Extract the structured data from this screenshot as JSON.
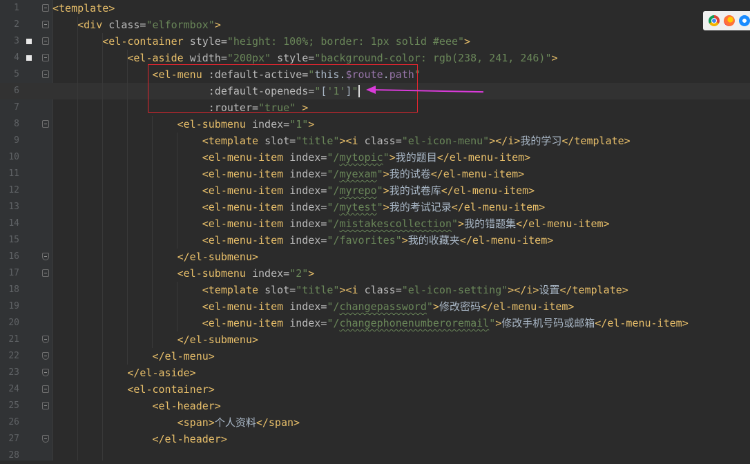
{
  "lines": [
    {
      "n": "1",
      "marker": false,
      "fold": "open",
      "tokens": [
        [
          "t",
          "<template>"
        ]
      ]
    },
    {
      "n": "2",
      "marker": false,
      "fold": "open",
      "tokens": [
        [
          "w",
          "    "
        ],
        [
          "t",
          "<div "
        ],
        [
          "a",
          "class="
        ],
        [
          "s",
          "\"elformbox\""
        ],
        [
          "t",
          ">"
        ]
      ]
    },
    {
      "n": "3",
      "marker": true,
      "fold": "open",
      "tokens": [
        [
          "w",
          "        "
        ],
        [
          "t",
          "<el-container "
        ],
        [
          "a",
          "style="
        ],
        [
          "s",
          "\"height: 100%; border: 1px solid #eee\""
        ],
        [
          "t",
          ">"
        ]
      ]
    },
    {
      "n": "4",
      "marker": true,
      "fold": "open",
      "tokens": [
        [
          "w",
          "            "
        ],
        [
          "t",
          "<el-aside "
        ],
        [
          "a",
          "width="
        ],
        [
          "s",
          "\"200px\" "
        ],
        [
          "a",
          "style="
        ],
        [
          "s",
          "\"background-color: rgb(238, 241, 246)\""
        ],
        [
          "t",
          ">"
        ]
      ]
    },
    {
      "n": "5",
      "marker": false,
      "fold": "open",
      "tokens": [
        [
          "w",
          "                "
        ],
        [
          "t",
          "<el-menu "
        ],
        [
          "a",
          ":default-active="
        ],
        [
          "s",
          "\""
        ],
        [
          "w",
          "this."
        ],
        [
          "vexpr",
          "$route"
        ],
        [
          "w",
          "."
        ],
        [
          "vexpr",
          "path"
        ],
        [
          "s",
          "\""
        ]
      ]
    },
    {
      "n": "6",
      "marker": false,
      "fold": "",
      "current": true,
      "tokens": [
        [
          "w",
          "                         "
        ],
        [
          "a",
          ":default-openeds="
        ],
        [
          "s",
          "\""
        ],
        [
          "w",
          "["
        ],
        [
          "s",
          "'1'"
        ],
        [
          "w",
          "]"
        ],
        [
          "s",
          "\""
        ]
      ]
    },
    {
      "n": "7",
      "marker": false,
      "fold": "",
      "tokens": [
        [
          "w",
          "                         "
        ],
        [
          "a",
          ":router="
        ],
        [
          "s",
          "\"true\" "
        ],
        [
          "t",
          ">"
        ]
      ]
    },
    {
      "n": "8",
      "marker": false,
      "fold": "open",
      "tokens": [
        [
          "w",
          "                    "
        ],
        [
          "t",
          "<el-submenu "
        ],
        [
          "a",
          "index="
        ],
        [
          "s",
          "\"1\""
        ],
        [
          "t",
          ">"
        ]
      ]
    },
    {
      "n": "9",
      "marker": false,
      "fold": "",
      "tokens": [
        [
          "w",
          "                        "
        ],
        [
          "t",
          "<template "
        ],
        [
          "a",
          "slot="
        ],
        [
          "s",
          "\"title\""
        ],
        [
          "t",
          "><i "
        ],
        [
          "a",
          "class="
        ],
        [
          "s",
          "\"el-icon-menu\""
        ],
        [
          "t",
          "></i>"
        ],
        [
          "w",
          "我的学习"
        ],
        [
          "t",
          "</template>"
        ]
      ]
    },
    {
      "n": "10",
      "marker": false,
      "fold": "",
      "tokens": [
        [
          "w",
          "                        "
        ],
        [
          "t",
          "<el-menu-item "
        ],
        [
          "a",
          "index="
        ],
        [
          "s",
          "\"/"
        ],
        [
          "sq",
          "mytopic"
        ],
        [
          "s",
          "\""
        ],
        [
          "t",
          ">"
        ],
        [
          "w",
          "我的题目"
        ],
        [
          "t",
          "</el-menu-item>"
        ]
      ]
    },
    {
      "n": "11",
      "marker": false,
      "fold": "",
      "tokens": [
        [
          "w",
          "                        "
        ],
        [
          "t",
          "<el-menu-item "
        ],
        [
          "a",
          "index="
        ],
        [
          "s",
          "\"/"
        ],
        [
          "sq",
          "myexam"
        ],
        [
          "s",
          "\""
        ],
        [
          "t",
          ">"
        ],
        [
          "w",
          "我的试卷"
        ],
        [
          "t",
          "</el-menu-item>"
        ]
      ]
    },
    {
      "n": "12",
      "marker": false,
      "fold": "",
      "tokens": [
        [
          "w",
          "                        "
        ],
        [
          "t",
          "<el-menu-item "
        ],
        [
          "a",
          "index="
        ],
        [
          "s",
          "\"/"
        ],
        [
          "sq",
          "myrepo"
        ],
        [
          "s",
          "\""
        ],
        [
          "t",
          ">"
        ],
        [
          "w",
          "我的试卷库"
        ],
        [
          "t",
          "</el-menu-item>"
        ]
      ]
    },
    {
      "n": "13",
      "marker": false,
      "fold": "",
      "tokens": [
        [
          "w",
          "                        "
        ],
        [
          "t",
          "<el-menu-item "
        ],
        [
          "a",
          "index="
        ],
        [
          "s",
          "\"/"
        ],
        [
          "sq",
          "mytest"
        ],
        [
          "s",
          "\""
        ],
        [
          "t",
          ">"
        ],
        [
          "w",
          "我的考试记录"
        ],
        [
          "t",
          "</el-menu-item>"
        ]
      ]
    },
    {
      "n": "14",
      "marker": false,
      "fold": "",
      "tokens": [
        [
          "w",
          "                        "
        ],
        [
          "t",
          "<el-menu-item "
        ],
        [
          "a",
          "index="
        ],
        [
          "s",
          "\"/"
        ],
        [
          "sq",
          "mistakescollection"
        ],
        [
          "s",
          "\""
        ],
        [
          "t",
          ">"
        ],
        [
          "w",
          "我的错题集"
        ],
        [
          "t",
          "</el-menu-item>"
        ]
      ]
    },
    {
      "n": "15",
      "marker": false,
      "fold": "",
      "tokens": [
        [
          "w",
          "                        "
        ],
        [
          "t",
          "<el-menu-item "
        ],
        [
          "a",
          "index="
        ],
        [
          "s",
          "\"/favorites\""
        ],
        [
          "t",
          ">"
        ],
        [
          "w",
          "我的收藏夹"
        ],
        [
          "t",
          "</el-menu-item>"
        ]
      ]
    },
    {
      "n": "16",
      "marker": false,
      "fold": "end",
      "tokens": [
        [
          "w",
          "                    "
        ],
        [
          "t",
          "</el-submenu>"
        ]
      ]
    },
    {
      "n": "17",
      "marker": false,
      "fold": "open",
      "tokens": [
        [
          "w",
          "                    "
        ],
        [
          "t",
          "<el-submenu "
        ],
        [
          "a",
          "index="
        ],
        [
          "s",
          "\"2\""
        ],
        [
          "t",
          ">"
        ]
      ]
    },
    {
      "n": "18",
      "marker": false,
      "fold": "",
      "tokens": [
        [
          "w",
          "                        "
        ],
        [
          "t",
          "<template "
        ],
        [
          "a",
          "slot="
        ],
        [
          "s",
          "\"title\""
        ],
        [
          "t",
          "><i "
        ],
        [
          "a",
          "class="
        ],
        [
          "s",
          "\"el-icon-setting\""
        ],
        [
          "t",
          "></i>"
        ],
        [
          "w",
          "设置"
        ],
        [
          "t",
          "</template>"
        ]
      ]
    },
    {
      "n": "19",
      "marker": false,
      "fold": "",
      "tokens": [
        [
          "w",
          "                        "
        ],
        [
          "t",
          "<el-menu-item "
        ],
        [
          "a",
          "index="
        ],
        [
          "s",
          "\"/"
        ],
        [
          "sq",
          "changepassword"
        ],
        [
          "s",
          "\""
        ],
        [
          "t",
          ">"
        ],
        [
          "w",
          "修改密码"
        ],
        [
          "t",
          "</el-menu-item>"
        ]
      ]
    },
    {
      "n": "20",
      "marker": false,
      "fold": "",
      "tokens": [
        [
          "w",
          "                        "
        ],
        [
          "t",
          "<el-menu-item "
        ],
        [
          "a",
          "index="
        ],
        [
          "s",
          "\"/"
        ],
        [
          "sq",
          "changephonenumberoremail"
        ],
        [
          "s",
          "\""
        ],
        [
          "t",
          ">"
        ],
        [
          "w",
          "修改手机号码或邮箱"
        ],
        [
          "t",
          "</el-menu-item>"
        ]
      ]
    },
    {
      "n": "21",
      "marker": false,
      "fold": "end",
      "tokens": [
        [
          "w",
          "                    "
        ],
        [
          "t",
          "</el-submenu>"
        ]
      ]
    },
    {
      "n": "22",
      "marker": false,
      "fold": "end",
      "tokens": [
        [
          "w",
          "                "
        ],
        [
          "t",
          "</el-menu>"
        ]
      ]
    },
    {
      "n": "23",
      "marker": false,
      "fold": "end",
      "tokens": [
        [
          "w",
          "            "
        ],
        [
          "t",
          "</el-aside>"
        ]
      ]
    },
    {
      "n": "24",
      "marker": false,
      "fold": "open",
      "tokens": [
        [
          "w",
          "            "
        ],
        [
          "t",
          "<el-container>"
        ]
      ]
    },
    {
      "n": "25",
      "marker": false,
      "fold": "open",
      "tokens": [
        [
          "w",
          "                "
        ],
        [
          "t",
          "<el-header>"
        ]
      ]
    },
    {
      "n": "26",
      "marker": false,
      "fold": "",
      "tokens": [
        [
          "w",
          "                    "
        ],
        [
          "t",
          "<span>"
        ],
        [
          "w",
          "个人资料"
        ],
        [
          "t",
          "</span>"
        ]
      ]
    },
    {
      "n": "27",
      "marker": false,
      "fold": "end",
      "tokens": [
        [
          "w",
          "                "
        ],
        [
          "t",
          "</el-header>"
        ]
      ]
    },
    {
      "n": "28",
      "marker": false,
      "fold": "",
      "tokens": []
    }
  ],
  "browser_icons": [
    "chrome-icon",
    "firefox-icon",
    "safari-icon"
  ],
  "colors": {
    "background": "#2b2b2b",
    "tag": "#e8bf6a",
    "attribute": "#bababa",
    "string": "#6a8759",
    "annotation_box": "#e2262f",
    "annotation_arrow": "#d93bd9"
  }
}
